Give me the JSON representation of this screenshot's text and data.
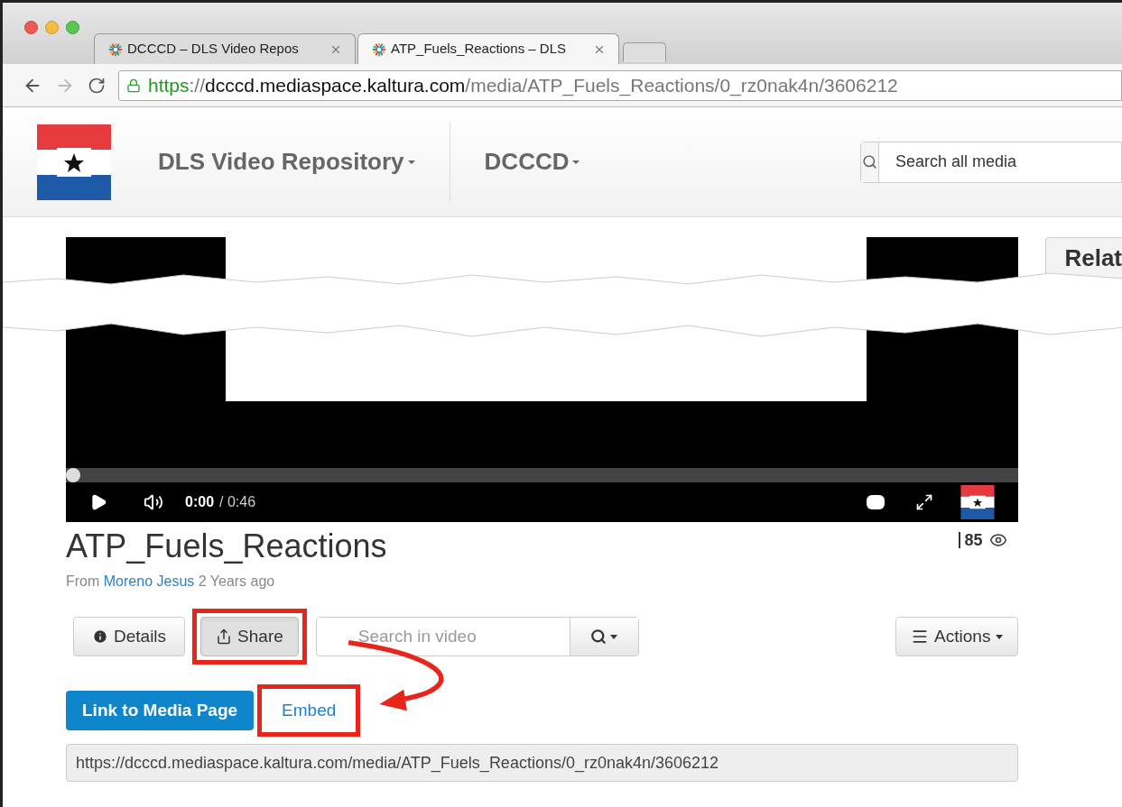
{
  "browser": {
    "tabs": [
      {
        "title": "DCCCD – DLS Video Repos",
        "selected": false
      },
      {
        "title": "ATP_Fuels_Reactions – DLS",
        "selected": true
      }
    ],
    "url": {
      "scheme": "https",
      "separator": "://",
      "host": "dcccd.mediaspace.kaltura.com",
      "path": "/media/ATP_Fuels_Reactions/0_rz0nak4n/3606212"
    }
  },
  "header": {
    "nav": [
      "DLS Video Repository",
      "DCCCD"
    ],
    "search": {
      "placeholder": "Search all media"
    }
  },
  "related_tab": "Relat",
  "player": {
    "time": "0:00",
    "duration": "/ 0:46",
    "level": 0
  },
  "media": {
    "title": "ATP_Fuels_Reactions",
    "views": "85",
    "byline": {
      "prefix": "From",
      "author": "Moreno Jesus",
      "age": "2 Years ago"
    }
  },
  "toolbar": {
    "details": "Details",
    "share": {
      "label": "Share",
      "selected": true
    },
    "search": {
      "placeholder": "Search in video"
    },
    "actions": "Actions"
  },
  "share_tabs": [
    {
      "label": "Link to Media Page",
      "selected": true
    },
    {
      "label": "Embed",
      "selected": false
    }
  ],
  "share_url": "https://dcccd.mediaspace.kaltura.com/media/ATP_Fuels_Reactions/0_rz0nak4n/3606212"
}
